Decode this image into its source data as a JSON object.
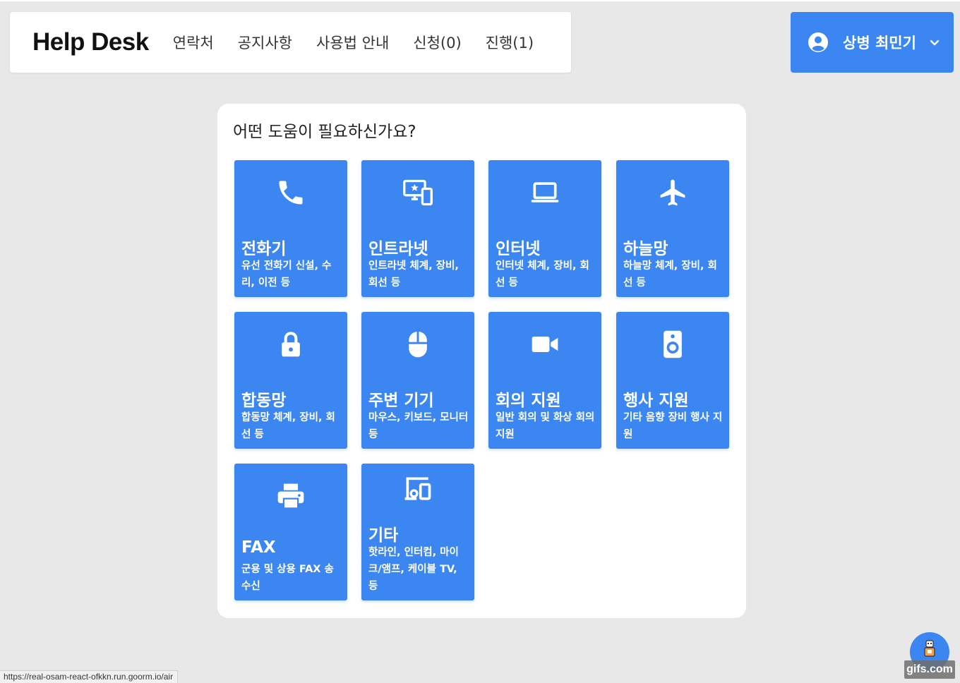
{
  "header": {
    "brand": "Help Desk",
    "nav": [
      {
        "label": "연락처"
      },
      {
        "label": "공지사항"
      },
      {
        "label": "사용법 안내"
      },
      {
        "label": "신청(0)"
      },
      {
        "label": "진행(1)"
      }
    ],
    "user": {
      "name": "상병 최민기",
      "icon": "user-circle-icon"
    }
  },
  "panel": {
    "title": "어떤 도움이 필요하신가요?",
    "cards": [
      {
        "title": "전화기",
        "desc": "유선 전화기 신설, 수리, 이전 등",
        "icon": "phone-icon"
      },
      {
        "title": "인트라넷",
        "desc": "인트라넷 체계, 장비, 회선 등",
        "icon": "desktop-mobile-icon"
      },
      {
        "title": "인터넷",
        "desc": "인터넷 체계, 장비, 회선 등",
        "icon": "laptop-icon"
      },
      {
        "title": "하늘망",
        "desc": "하늘망 체계, 장비, 회선 등",
        "icon": "airplane-icon"
      },
      {
        "title": "합동망",
        "desc": "합동망 체계, 장비, 회선 등",
        "icon": "lock-icon"
      },
      {
        "title": "주변 기기",
        "desc": "마우스, 키보드, 모니터 등",
        "icon": "mouse-icon"
      },
      {
        "title": "회의 지원",
        "desc": "일반 회의 및 화상 회의 지원",
        "icon": "video-camera-icon"
      },
      {
        "title": "행사 지원",
        "desc": "기타 음향 장비 행사 지원",
        "icon": "speaker-icon"
      },
      {
        "title": "FAX",
        "desc": "군용 및 상용 FAX 송수신",
        "icon": "printer-icon"
      },
      {
        "title": "기타",
        "desc": "핫라인, 인터컴, 마이크/앰프, 케이블 TV, 등",
        "icon": "devices-icon"
      }
    ]
  },
  "status_bar": {
    "url": "https://real-osam-react-ofkkn.run.goorm.io/air"
  },
  "watermark": "gifs.com",
  "colors": {
    "primary": "#3b86f0",
    "background": "#e8e8e8",
    "panel": "#ffffff"
  }
}
